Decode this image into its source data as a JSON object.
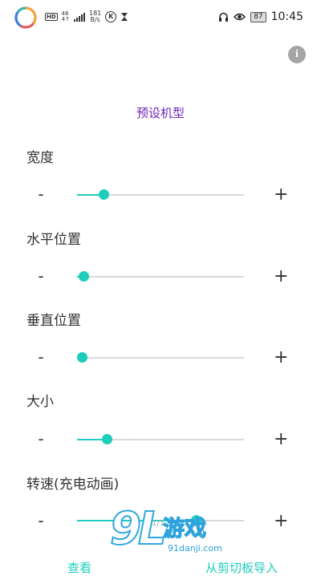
{
  "status_bar": {
    "hd_badge": "HD",
    "network": "46",
    "network_sub": "4↑",
    "speed_value": "181",
    "speed_unit": "B/s",
    "k_label": "K",
    "battery": "87",
    "time": "10:45"
  },
  "page": {
    "title": "预设机型"
  },
  "controls": {
    "minus_label": "-",
    "plus_label": "+"
  },
  "settings": [
    {
      "label": "宽度",
      "value": 0.16
    },
    {
      "label": "水平位置",
      "value": 0.04
    },
    {
      "label": "垂直位置",
      "value": 0.0
    },
    {
      "label": "大小",
      "value": 0.18
    },
    {
      "label": "转速(充电动画)",
      "value": 0.71
    }
  ],
  "pager": {
    "text": "1/1"
  },
  "bottom_actions": {
    "view_label": "查看",
    "import_label": "从剪切板导入"
  },
  "watermark": {
    "logo": "9L",
    "text": "游戏",
    "domain": "91danji.com"
  },
  "colors": {
    "accent": "#1fcdbd",
    "title": "#6d27b8"
  }
}
